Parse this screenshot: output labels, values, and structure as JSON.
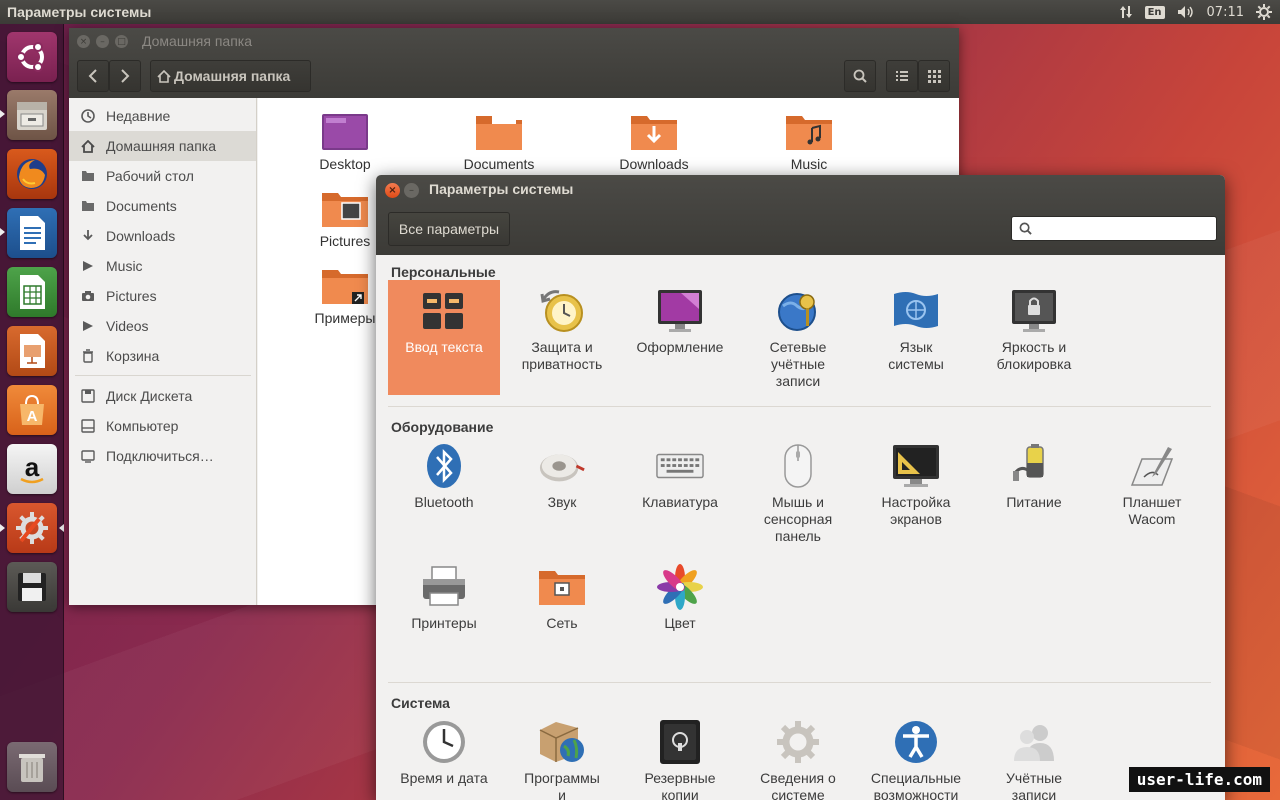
{
  "top_panel": {
    "title": "Параметры системы",
    "lang": "En",
    "time": "07:11"
  },
  "launcher": {
    "items": [
      "ubuntu-logo-icon",
      "files-icon",
      "firefox-icon",
      "writer-icon",
      "calc-icon",
      "impress-icon",
      "software-center-icon",
      "amazon-icon",
      "system-settings-icon",
      "floppy-icon",
      "trash-icon"
    ]
  },
  "files": {
    "title": "Домашняя папка",
    "path_label": "Домашняя папка",
    "sidebar": [
      {
        "label": "Недавние",
        "icon": "clock-icon"
      },
      {
        "label": "Домашняя папка",
        "icon": "home-icon"
      },
      {
        "label": "Рабочий стол",
        "icon": "folder-icon"
      },
      {
        "label": "Documents",
        "icon": "folder-icon"
      },
      {
        "label": "Downloads",
        "icon": "download-icon"
      },
      {
        "label": "Music",
        "icon": "music-icon"
      },
      {
        "label": "Pictures",
        "icon": "camera-icon"
      },
      {
        "label": "Videos",
        "icon": "video-icon"
      },
      {
        "label": "Корзина",
        "icon": "trash-icon"
      },
      {
        "label": "Диск Дискета",
        "icon": "disk-icon"
      },
      {
        "label": "Компьютер",
        "icon": "computer-icon"
      },
      {
        "label": "Подключиться…",
        "icon": "network-icon"
      }
    ],
    "folders": [
      "Desktop",
      "Documents",
      "Downloads",
      "Music",
      "Pictures",
      "Примеры"
    ]
  },
  "settings": {
    "title": "Параметры системы",
    "all_params": "Все параметры",
    "search_placeholder": "",
    "sections": {
      "personal": {
        "title": "Персональные",
        "items": [
          {
            "l1": "Ввод текста",
            "l2": "",
            "l3": ""
          },
          {
            "l1": "Защита и",
            "l2": "приватность",
            "l3": ""
          },
          {
            "l1": "Оформление",
            "l2": "",
            "l3": ""
          },
          {
            "l1": "Сетевые",
            "l2": "учётные",
            "l3": "записи"
          },
          {
            "l1": "Язык",
            "l2": "системы",
            "l3": ""
          },
          {
            "l1": "Яркость и",
            "l2": "блокировка",
            "l3": ""
          }
        ]
      },
      "hardware": {
        "title": "Оборудование",
        "items": [
          {
            "l1": "Bluetooth",
            "l2": "",
            "l3": ""
          },
          {
            "l1": "Звук",
            "l2": "",
            "l3": ""
          },
          {
            "l1": "Клавиатура",
            "l2": "",
            "l3": ""
          },
          {
            "l1": "Мышь и",
            "l2": "сенсорная",
            "l3": "панель"
          },
          {
            "l1": "Настройка",
            "l2": "экранов",
            "l3": ""
          },
          {
            "l1": "Питание",
            "l2": "",
            "l3": ""
          },
          {
            "l1": "Планшет",
            "l2": "Wacom",
            "l3": ""
          },
          {
            "l1": "Принтеры",
            "l2": "",
            "l3": ""
          },
          {
            "l1": "Сеть",
            "l2": "",
            "l3": ""
          },
          {
            "l1": "Цвет",
            "l2": "",
            "l3": ""
          }
        ]
      },
      "system": {
        "title": "Система",
        "items": [
          {
            "l1": "Время и дата",
            "l2": "",
            "l3": ""
          },
          {
            "l1": "Программы",
            "l2": "и",
            "l3": ""
          },
          {
            "l1": "Резервные",
            "l2": "копии",
            "l3": ""
          },
          {
            "l1": "Сведения о",
            "l2": "системе",
            "l3": ""
          },
          {
            "l1": "Специальные",
            "l2": "возможности",
            "l3": ""
          },
          {
            "l1": "Учётные",
            "l2": "записи",
            "l3": ""
          }
        ]
      }
    }
  },
  "watermark": "user-life.com",
  "colors": {
    "accent": "#f08a5d",
    "panel": "#3c3b37",
    "close": "#df4a16"
  }
}
